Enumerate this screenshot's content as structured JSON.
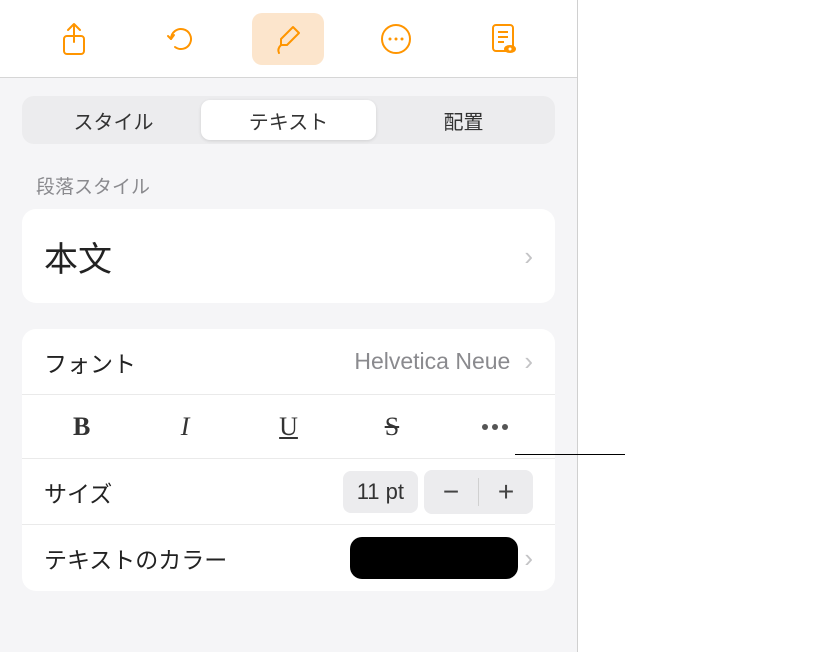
{
  "toolbar": {
    "icons": [
      "share",
      "undo",
      "brush",
      "more",
      "document-view"
    ]
  },
  "tabs": {
    "items": [
      {
        "label": "スタイル",
        "active": false
      },
      {
        "label": "テキスト",
        "active": true
      },
      {
        "label": "配置",
        "active": false
      }
    ]
  },
  "paragraph": {
    "section_label": "段落スタイル",
    "value": "本文"
  },
  "font": {
    "label": "フォント",
    "value": "Helvetica Neue"
  },
  "format_buttons": {
    "bold": "B",
    "italic": "I",
    "underline": "U",
    "strike": "S"
  },
  "size": {
    "label": "サイズ",
    "value": "11 pt"
  },
  "text_color": {
    "label": "テキストのカラー",
    "value": "#000000"
  }
}
